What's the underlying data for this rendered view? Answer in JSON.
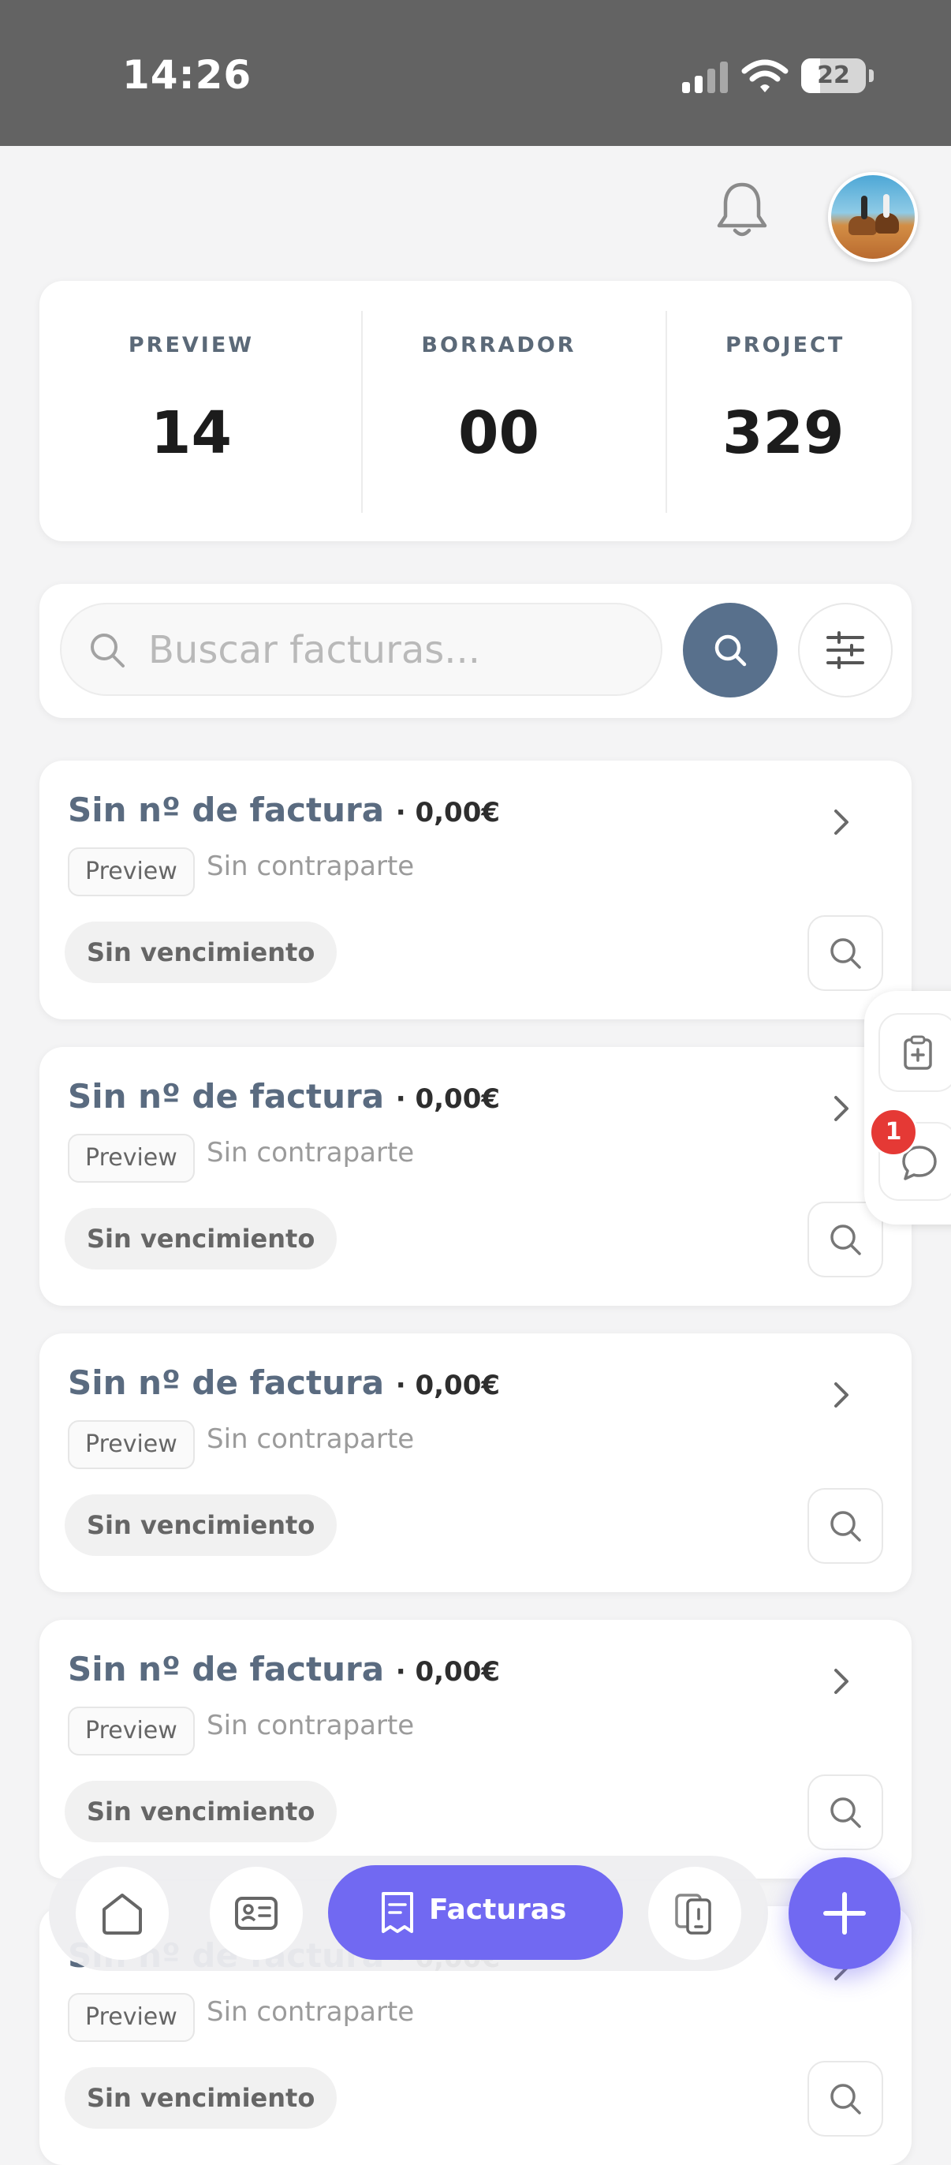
{
  "status_bar": {
    "time": "14:26",
    "battery": "22"
  },
  "stats": [
    {
      "label": "PREVIEW",
      "value": "14"
    },
    {
      "label": "BORRADOR",
      "value": "00"
    },
    {
      "label": "PROJECT",
      "value": "329"
    }
  ],
  "search": {
    "placeholder": "Buscar facturas..."
  },
  "invoices": [
    {
      "title": "Sin nº de factura",
      "amount": "· 0,00€",
      "status": "Preview",
      "counterparty": "Sin contraparte",
      "due": "Sin vencimiento"
    },
    {
      "title": "Sin nº de factura",
      "amount": "· 0,00€",
      "status": "Preview",
      "counterparty": "Sin contraparte",
      "due": "Sin vencimiento"
    },
    {
      "title": "Sin nº de factura",
      "amount": "· 0,00€",
      "status": "Preview",
      "counterparty": "Sin contraparte",
      "due": "Sin vencimiento"
    },
    {
      "title": "Sin nº de factura",
      "amount": "· 0,00€",
      "status": "Preview",
      "counterparty": "Sin contraparte",
      "due": "Sin vencimiento"
    },
    {
      "title": "Sin nº de factura",
      "amount": "· 0,00€",
      "status": "Preview",
      "counterparty": "Sin contraparte",
      "due": "Sin vencimiento"
    }
  ],
  "side_tool": {
    "notification_count": "1"
  },
  "bottom_nav": {
    "active_label": "Facturas"
  },
  "colors": {
    "accent": "#7169f2",
    "search_button": "#58708c",
    "title": "#5a6b80",
    "badge": "#e53935"
  }
}
